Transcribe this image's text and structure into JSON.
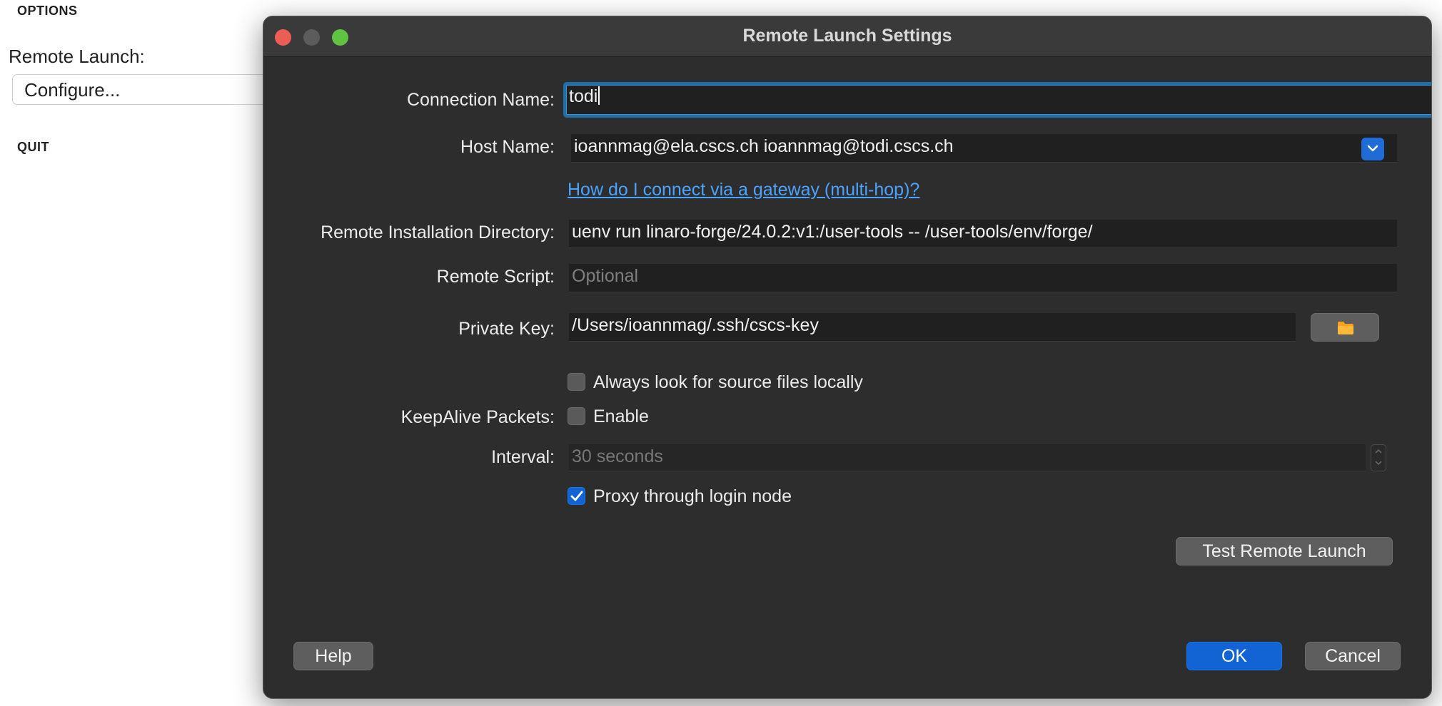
{
  "background": {
    "options_heading": "OPTIONS",
    "remote_launch_label": "Remote Launch:",
    "configure_button": "Configure...",
    "quit_heading": "QUIT"
  },
  "dialog": {
    "title": "Remote Launch Settings",
    "connection_name": {
      "label": "Connection Name:",
      "value": "todi"
    },
    "host_name": {
      "label": "Host Name:",
      "value": "ioannmag@ela.cscs.ch ioannmag@todi.cscs.ch"
    },
    "gateway_link": "How do I connect via a gateway (multi-hop)?",
    "install_dir": {
      "label": "Remote Installation Directory:",
      "value": "uenv run linaro-forge/24.0.2:v1:/user-tools -- /user-tools/env/forge/"
    },
    "remote_script": {
      "label": "Remote Script:",
      "placeholder": "Optional"
    },
    "private_key": {
      "label": "Private Key:",
      "value": "/Users/ioannmag/.ssh/cscs-key"
    },
    "source_files": {
      "label": "Always look for source files locally",
      "checked": false
    },
    "keepalive": {
      "label": "KeepAlive Packets:",
      "checkbox_label": "Enable",
      "checked": false
    },
    "interval": {
      "label": "Interval:",
      "value": "30 seconds"
    },
    "proxy": {
      "label": "Proxy through login node",
      "checked": true
    },
    "test_button": "Test Remote Launch",
    "help_button": "Help",
    "ok_button": "OK",
    "cancel_button": "Cancel",
    "colors": {
      "accent": "#1264d4",
      "link": "#4aa3ff",
      "background": "#2d2d2d"
    }
  }
}
